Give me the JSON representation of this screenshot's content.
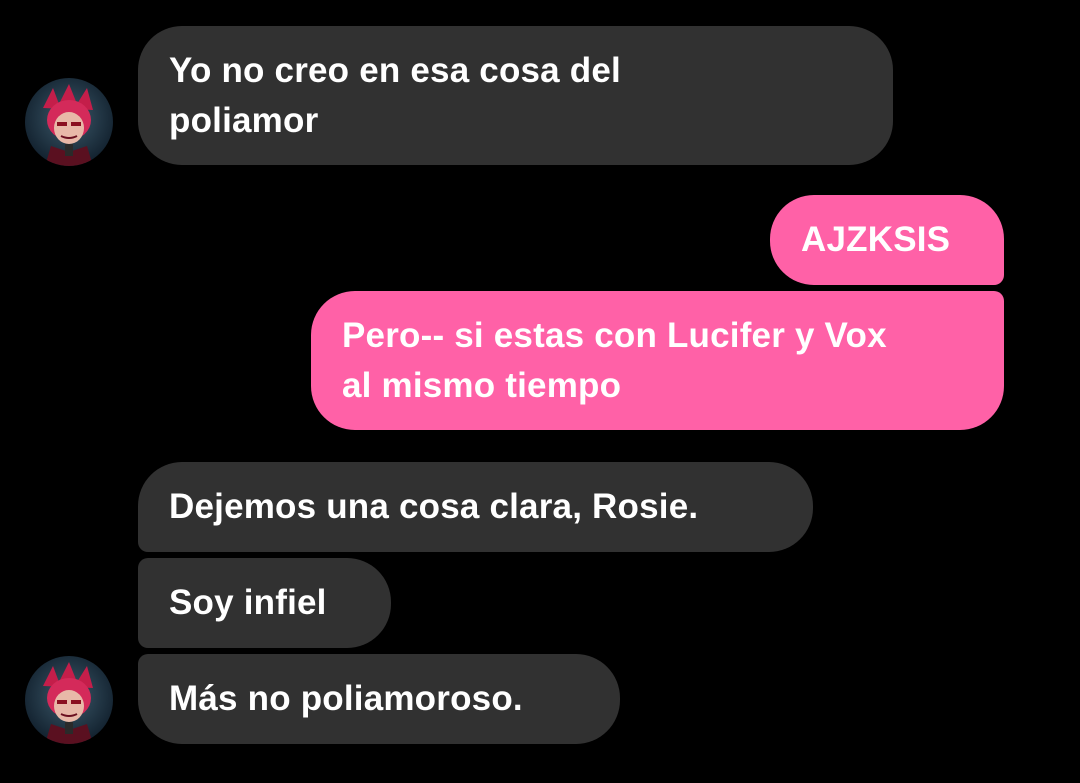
{
  "colors": {
    "background": "#000000",
    "incoming_bubble": "#313131",
    "outgoing_bubble": "#ff61a7",
    "text": "#ffffff"
  },
  "messages": [
    {
      "direction": "incoming",
      "lines": [
        "Yo no creo en esa cosa del",
        "poliamor"
      ],
      "avatar": "contact-avatar"
    },
    {
      "direction": "outgoing",
      "lines": [
        "AJZKSIS"
      ]
    },
    {
      "direction": "outgoing",
      "lines": [
        "Pero-- si estas con Lucifer y Vox",
        "al mismo tiempo"
      ]
    },
    {
      "direction": "incoming",
      "lines": [
        "Dejemos una cosa clara, Rosie."
      ]
    },
    {
      "direction": "incoming",
      "lines": [
        "Soy infiel"
      ]
    },
    {
      "direction": "incoming",
      "lines": [
        "Más no poliamoroso."
      ],
      "avatar": "contact-avatar"
    }
  ]
}
